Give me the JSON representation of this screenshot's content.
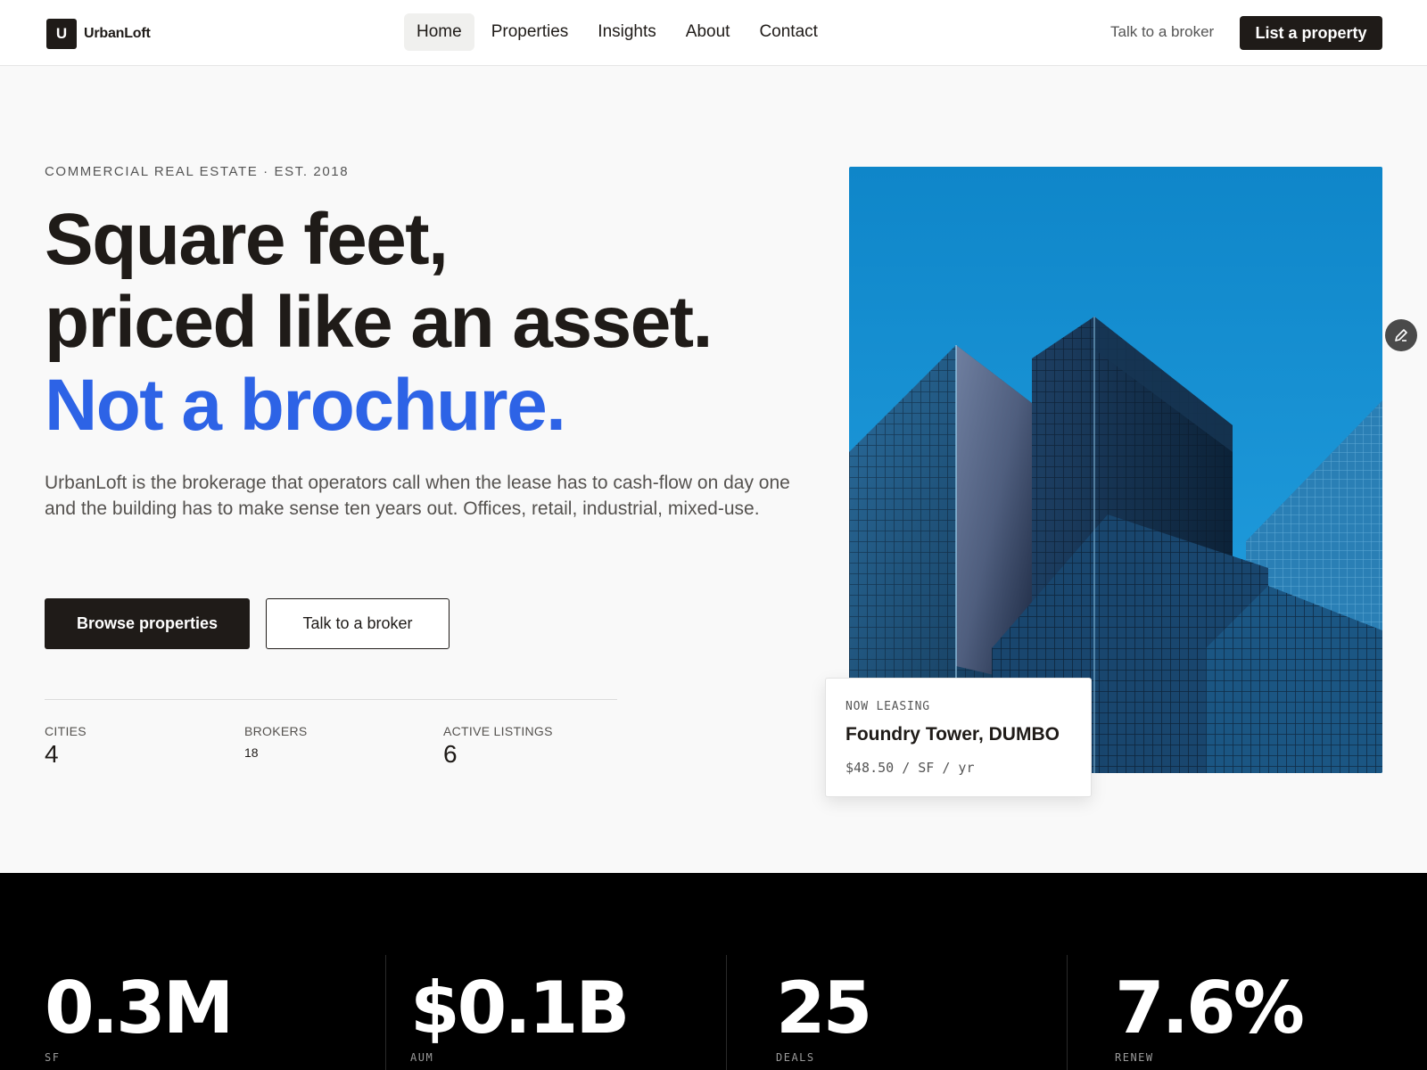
{
  "header": {
    "brand_mark": "U",
    "brand_name": "UrbanLoft",
    "nav": [
      {
        "label": "Home",
        "active": true
      },
      {
        "label": "Properties",
        "active": false
      },
      {
        "label": "Insights",
        "active": false
      },
      {
        "label": "About",
        "active": false
      },
      {
        "label": "Contact",
        "active": false
      }
    ],
    "broker_link": "Talk to a broker",
    "cta": "List a property"
  },
  "hero": {
    "eyebrow": "COMMERCIAL REAL ESTATE · EST. 2018",
    "headline_line1": "Square feet,",
    "headline_line2": "priced like an asset.",
    "headline_accent": "Not a brochure.",
    "lede": "UrbanLoft is the brokerage that operators call when the lease has to cash-flow on day one and the building has to make sense ten years out. Offices, retail, industrial, mixed-use.",
    "primary_button": "Browse properties",
    "secondary_button": "Talk to a broker",
    "stats": [
      {
        "label": "CITIES",
        "value": "4"
      },
      {
        "label": "BROKERS",
        "value": "18"
      },
      {
        "label": "ACTIVE LISTINGS",
        "value": "6"
      }
    ],
    "image": "glass-office-towers-photo"
  },
  "lease_card": {
    "eyebrow": "NOW LEASING",
    "title": "Foundry Tower, DUMBO",
    "price": "$48.50 / SF / yr"
  },
  "metrics": [
    {
      "value": "0.3M",
      "label": "SF"
    },
    {
      "value": "$0.1B",
      "label": "AUM"
    },
    {
      "value": "25",
      "label": "DEALS"
    },
    {
      "value": "7.6%",
      "label": "RENEW"
    }
  ],
  "colors": {
    "ink": "#1f1b18",
    "accent": "#2d63e6",
    "background": "#f9f9f9",
    "band": "#000000"
  },
  "icons": {
    "edit_fab": "pencil-icon"
  }
}
